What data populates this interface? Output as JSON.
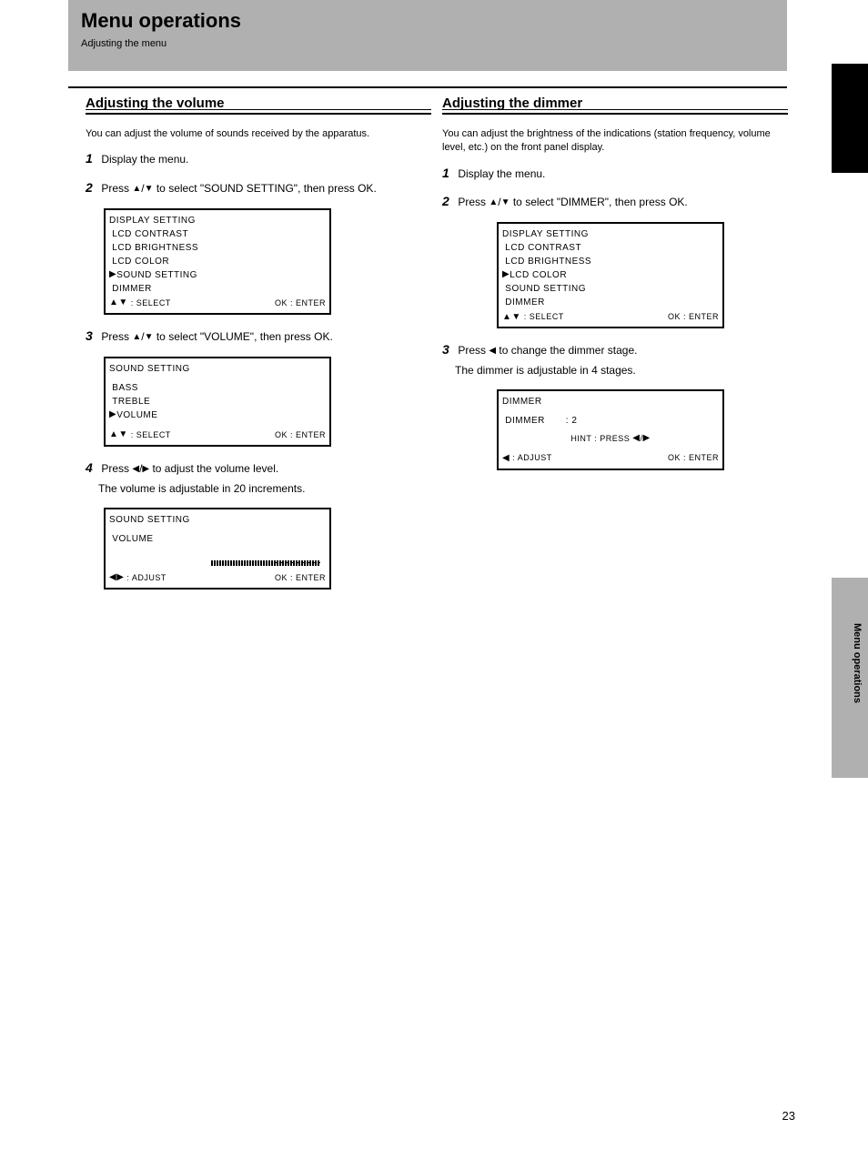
{
  "header": {
    "title": "Menu operations",
    "subtitle": "Adjusting the menu"
  },
  "page_number": "23",
  "side_label": "Menu operations",
  "left": {
    "heading": "Adjusting the volume",
    "sub": "You can adjust the volume of sounds received by the apparatus.",
    "steps": [
      "Display the menu.",
      "Press `/` to select \"SOUND SETTING\", then press OK.",
      "Press `/` to select \"VOLUME\", then press OK.",
      "Press \"/\" to adjust the volume level."
    ],
    "step4_note": "The volume is adjustable in 20 increments.",
    "box1": {
      "title": "DISPLAY SETTING",
      "items": [
        "LCD CONTRAST",
        "LCD BRIGHTNESS",
        "LCD COLOR",
        "SOUND SETTING",
        "DIMMER"
      ],
      "footer_left": "`! : SELECT",
      "footer_right": "OK : ENTER"
    },
    "box2": {
      "title": "SOUND SETTING",
      "items": [
        "BASS",
        "TREBLE",
        "VOLUME"
      ],
      "footer_left": "`! : SELECT",
      "footer_right": "OK : ENTER"
    },
    "box3": {
      "title": "SOUND SETTING",
      "sub1": "VOLUME",
      "footer_left": "\"\" : ADJUST",
      "footer_right": "OK : ENTER"
    }
  },
  "right": {
    "heading": "Adjusting the dimmer",
    "sub": "You can adjust the brightness of the indications (station frequency, volume level, etc.) on the front panel display.",
    "steps": [
      "Display the menu.",
      "Press `/` to select \"DIMMER\", then press OK.",
      "Press \" to change the dimmer stage."
    ],
    "step3_note": "The dimmer is adjustable in 4 stages.",
    "box1": {
      "title": "DISPLAY SETTING",
      "items": [
        "LCD CONTRAST",
        "LCD BRIGHTNESS",
        "LCD COLOR",
        "SOUND SETTING",
        "DIMMER"
      ],
      "footer_left": "`! : SELECT",
      "footer_right": "OK : ENTER"
    },
    "box2": {
      "title": "DIMMER",
      "line1_left": "DIMMER",
      "line1_right": ": 2",
      "hint": "HINT : PRESS \"/\"",
      "footer_left": "\" : ADJUST",
      "footer_right": "OK : ENTER"
    }
  }
}
